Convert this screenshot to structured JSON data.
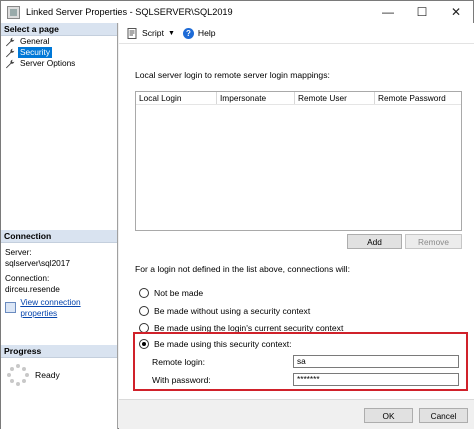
{
  "window": {
    "title": "Linked Server Properties - SQLSERVER\\SQL2019",
    "minimize_glyph": "—",
    "maximize_glyph": "☐",
    "close_glyph": "✕"
  },
  "left": {
    "select_page_header": "Select a page",
    "pages": [
      {
        "label": "General",
        "selected": false
      },
      {
        "label": "Security",
        "selected": true
      },
      {
        "label": "Server Options",
        "selected": false
      }
    ],
    "connection_header": "Connection",
    "server_label": "Server:",
    "server_value": "sqlserver\\sql2017",
    "connection_label": "Connection:",
    "connection_value": "dirceu.resende",
    "view_link": "View connection properties",
    "progress_header": "Progress",
    "progress_status": "Ready"
  },
  "toolbar": {
    "script_label": "Script",
    "help_label": "Help"
  },
  "main": {
    "mapping_label": "Local server login to remote server login mappings:",
    "columns": [
      "Local Login",
      "Impersonate",
      "Remote User",
      "Remote Password"
    ],
    "add_button": "Add",
    "remove_button": "Remove",
    "for_login_label": "For a login not defined in the list above, connections will:",
    "options": [
      {
        "label": "Not be made",
        "checked": false
      },
      {
        "label": "Be made without using a security context",
        "checked": false
      },
      {
        "label": "Be made using the login's current security context",
        "checked": false
      },
      {
        "label": "Be made using this security context:",
        "checked": true
      }
    ],
    "remote_login_label": "Remote login:",
    "remote_login_value": "sa",
    "password_label": "With password:",
    "password_value": "*******"
  },
  "footer": {
    "ok_button": "OK",
    "cancel_button": "Cancel"
  },
  "colors": {
    "highlight": "#d0212a",
    "selection": "#0078d7",
    "link": "#0645ad"
  }
}
